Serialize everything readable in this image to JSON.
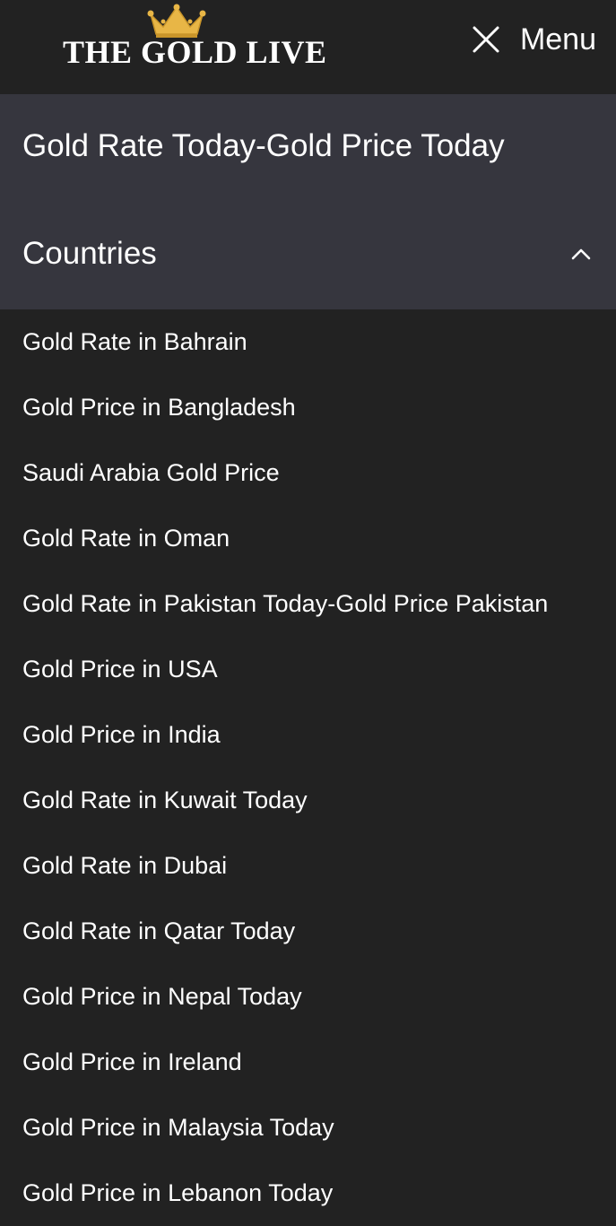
{
  "header": {
    "logo_text": "THE GOLD LIVE",
    "menu_label": "Menu",
    "icons": {
      "logo": "crown-icon",
      "toggle": "close-icon"
    }
  },
  "panel": {
    "top_link": "Gold Rate Today-Gold Price Today",
    "section_label": "Countries",
    "section_icon": "chevron-up-icon"
  },
  "countries": [
    {
      "label": "Gold Rate in Bahrain"
    },
    {
      "label": "Gold Price in Bangladesh"
    },
    {
      "label": "Saudi Arabia Gold Price"
    },
    {
      "label": "Gold Rate in Oman"
    },
    {
      "label": "Gold Rate in Pakistan Today-Gold Price Pakistan"
    },
    {
      "label": "Gold Price in USA"
    },
    {
      "label": "Gold Price in India"
    },
    {
      "label": "Gold Rate in Kuwait Today"
    },
    {
      "label": "Gold Rate in Dubai"
    },
    {
      "label": "Gold Rate in Qatar Today"
    },
    {
      "label": "Gold Price in Nepal Today"
    },
    {
      "label": "Gold Price in Ireland"
    },
    {
      "label": "Gold Price in Malaysia Today"
    },
    {
      "label": "Gold Price in Lebanon Today"
    }
  ],
  "colors": {
    "background": "#222222",
    "panel": "#36363e",
    "text": "#ffffff",
    "gold": "#e8b646"
  }
}
